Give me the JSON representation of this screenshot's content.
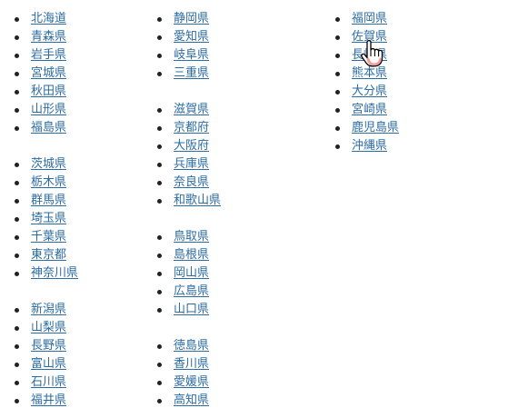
{
  "columns": [
    {
      "groups": [
        {
          "items": [
            "北海道",
            "青森県",
            "岩手県",
            "宮城県",
            "秋田県",
            "山形県",
            "福島県"
          ]
        },
        {
          "items": [
            "茨城県",
            "栃木県",
            "群馬県",
            "埼玉県",
            "千葉県",
            "東京都",
            "神奈川県"
          ]
        },
        {
          "items": [
            "新潟県",
            "山梨県",
            "長野県",
            "富山県",
            "石川県",
            "福井県"
          ]
        }
      ]
    },
    {
      "groups": [
        {
          "items": [
            "静岡県",
            "愛知県",
            "岐阜県",
            "三重県"
          ]
        },
        {
          "items": [
            "滋賀県",
            "京都府",
            "大阪府",
            "兵庫県",
            "奈良県",
            "和歌山県"
          ]
        },
        {
          "items": [
            "鳥取県",
            "島根県",
            "岡山県",
            "広島県",
            "山口県"
          ]
        },
        {
          "items": [
            "徳島県",
            "香川県",
            "愛媛県",
            "高知県"
          ]
        }
      ]
    },
    {
      "groups": [
        {
          "items": [
            "福岡県",
            "佐賀県",
            "長崎県",
            "熊本県",
            "大分県",
            "宮崎県",
            "鹿児島県",
            "沖縄県"
          ]
        }
      ]
    }
  ],
  "cursor": {
    "icon": "hand-pointer-icon",
    "hovered_item": "佐賀県"
  },
  "colors": {
    "link": "#2b6ca3",
    "bullet": "#222222",
    "background": "#ffffff"
  }
}
